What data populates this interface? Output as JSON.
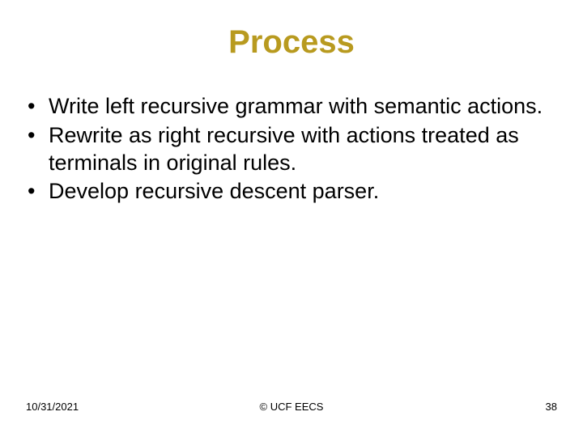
{
  "title": "Process",
  "bullets": [
    "Write left recursive grammar with semantic actions.",
    "Rewrite as right recursive with actions treated as terminals in original rules.",
    "Develop recursive descent parser."
  ],
  "footer": {
    "date": "10/31/2021",
    "copyright": "© UCF EECS",
    "page": "38"
  }
}
